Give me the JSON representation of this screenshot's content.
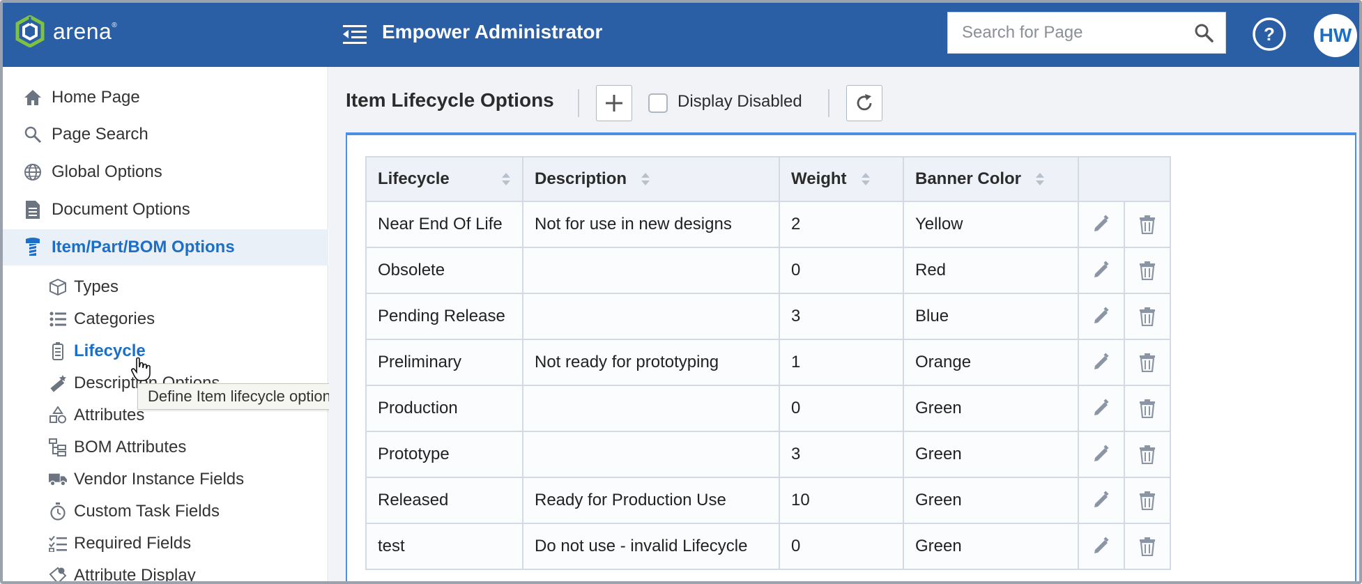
{
  "header": {
    "brand": "arena",
    "app_title": "Empower Administrator",
    "search_placeholder": "Search for Page",
    "avatar_initials": "HW",
    "help_icon": "question-circle-icon",
    "colors": {
      "bar": "#2a5fa6",
      "accent": "#1b6fc6"
    }
  },
  "sidebar": {
    "items": [
      {
        "label": "Home Page",
        "icon": "home-icon"
      },
      {
        "label": "Page Search",
        "icon": "search-icon"
      },
      {
        "label": "Global Options",
        "icon": "globe-icon"
      },
      {
        "label": "Document Options",
        "icon": "document-icon"
      },
      {
        "label": "Item/Part/BOM Options",
        "icon": "screw-icon",
        "active": true
      }
    ],
    "sub_items": [
      {
        "label": "Types",
        "icon": "cube-icon"
      },
      {
        "label": "Categories",
        "icon": "list-icon"
      },
      {
        "label": "Lifecycle",
        "icon": "battery-icon",
        "current": true
      },
      {
        "label": "Description Options",
        "icon": "magic-wand-icon"
      },
      {
        "label": "Attributes",
        "icon": "shapes-icon"
      },
      {
        "label": "BOM Attributes",
        "icon": "tree-icon"
      },
      {
        "label": "Vendor Instance Fields",
        "icon": "truck-icon"
      },
      {
        "label": "Custom Task Fields",
        "icon": "stopwatch-icon"
      },
      {
        "label": "Required Fields",
        "icon": "checklist-icon"
      },
      {
        "label": "Attribute Display",
        "icon": "tag-icon"
      }
    ],
    "tooltip": "Define Item lifecycle options"
  },
  "main": {
    "title": "Item Lifecycle Options",
    "display_disabled_label": "Display Disabled",
    "display_disabled_checked": false,
    "table": {
      "columns": [
        "Lifecycle",
        "Description",
        "Weight",
        "Banner Color"
      ],
      "rows": [
        {
          "lifecycle": "Near End Of Life",
          "description": "Not for use in new designs",
          "weight": "2",
          "banner_color": "Yellow"
        },
        {
          "lifecycle": "Obsolete",
          "description": "",
          "weight": "0",
          "banner_color": "Red"
        },
        {
          "lifecycle": "Pending Release",
          "description": "",
          "weight": "3",
          "banner_color": "Blue"
        },
        {
          "lifecycle": "Preliminary",
          "description": "Not ready for prototyping",
          "weight": "1",
          "banner_color": "Orange"
        },
        {
          "lifecycle": "Production",
          "description": "",
          "weight": "0",
          "banner_color": "Green"
        },
        {
          "lifecycle": "Prototype",
          "description": "",
          "weight": "3",
          "banner_color": "Green"
        },
        {
          "lifecycle": "Released",
          "description": "Ready for Production Use",
          "weight": "10",
          "banner_color": "Green"
        },
        {
          "lifecycle": "test",
          "description": "Do not use - invalid Lifecycle",
          "weight": "0",
          "banner_color": "Green"
        }
      ]
    }
  }
}
